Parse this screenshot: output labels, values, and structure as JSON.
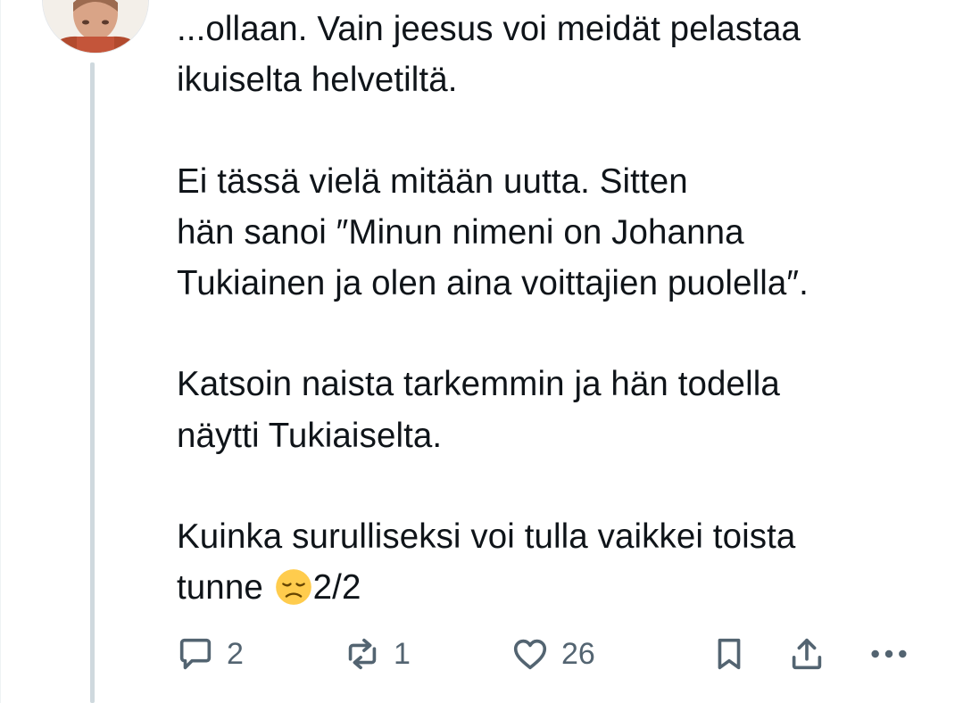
{
  "tweet": {
    "lines": [
      [
        " ...ollaan. Vain jeesus voi meidät pelastaa",
        "ikuiselta helvetiltä."
      ],
      [
        "Ei tässä vielä mitään uutta. Sitten",
        "hän sanoi ″Minun nimeni on Johanna",
        "Tukiainen ja olen aina voittajien puolella″."
      ],
      [
        "Katsoin naista tarkemmin ja hän todella",
        "näytti Tukiaiselta."
      ],
      [
        "Kuinka surulliseksi voi tulla vaikkei toista"
      ]
    ],
    "last_line_before_emoji": "tunne ",
    "emoji": "disappointed-face-emoji",
    "last_line_after_emoji": "2/2"
  },
  "actions": {
    "reply_count": "2",
    "retweet_count": "1",
    "like_count": "26"
  },
  "icons": {
    "reply": "reply-icon",
    "retweet": "retweet-icon",
    "like": "heart-icon",
    "bookmark": "bookmark-icon",
    "share": "share-icon",
    "more": "more-icon"
  },
  "colors": {
    "text": "#0f1419",
    "secondary": "#536471",
    "thread_line": "#cfd9de",
    "emoji_face": "#ffcc4d"
  }
}
